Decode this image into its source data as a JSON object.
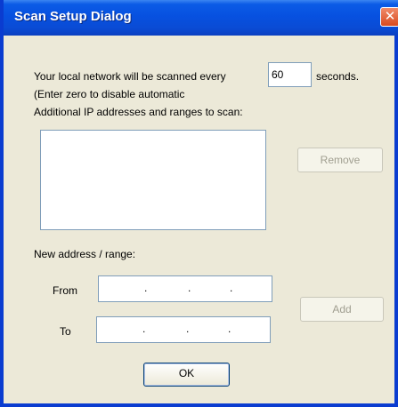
{
  "window": {
    "title": "Scan Setup Dialog",
    "close_glyph": "✕"
  },
  "scan": {
    "line_before": "Your local network will be scanned every",
    "interval_value": "60",
    "line_after": "seconds.",
    "hint": "(Enter zero to disable automatic"
  },
  "additional": {
    "label": "Additional IP addresses and ranges to scan:",
    "items": []
  },
  "buttons": {
    "remove": "Remove",
    "add": "Add",
    "ok": "OK"
  },
  "new_range": {
    "label": "New address / range:",
    "from_label": "From",
    "to_label": "To",
    "dot": "."
  },
  "icons": {
    "close": "close-icon"
  },
  "colors": {
    "titlebar": "#0a4bd4",
    "dialog_bg": "#ece9d8",
    "disabled_text": "#a09e90"
  }
}
